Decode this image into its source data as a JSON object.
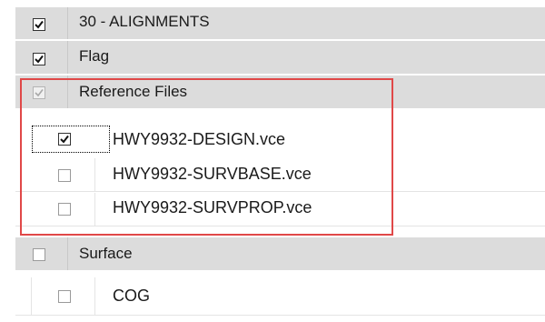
{
  "tree": {
    "rows": [
      {
        "label": "30 - ALIGNMENTS",
        "checked": true
      },
      {
        "label": "Flag",
        "checked": true
      },
      {
        "label": "Reference Files",
        "checked": true,
        "state": "disabled"
      },
      {
        "label": "HWY9932-DESIGN.vce",
        "checked": true,
        "focused": true
      },
      {
        "label": "HWY9932-SURVBASE.vce",
        "checked": false
      },
      {
        "label": "HWY9932-SURVPROP.vce",
        "checked": false
      },
      {
        "label": "Surface",
        "checked": false
      },
      {
        "label": "COG",
        "checked": false
      }
    ]
  },
  "highlight": {
    "color": "#e04848"
  }
}
